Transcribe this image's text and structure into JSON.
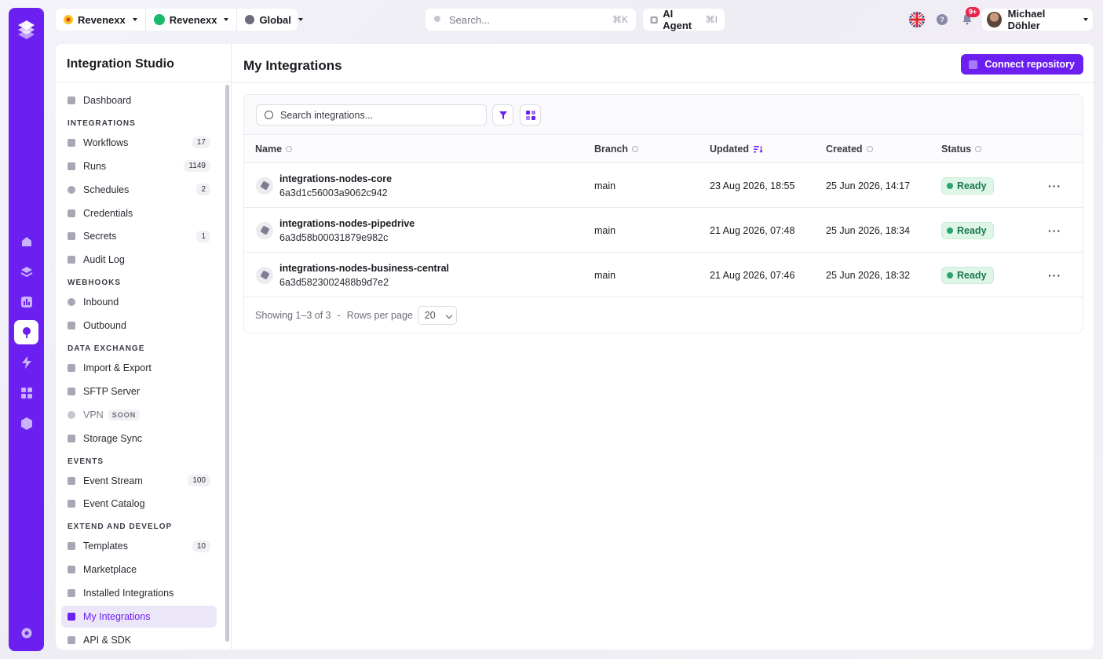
{
  "topbar": {
    "org_switch": [
      {
        "label": "Revenexx",
        "color": "#f5c518"
      },
      {
        "label": "Revenexx",
        "color": "#19b86b"
      },
      {
        "label": "Global",
        "color": "#6b6b7a"
      }
    ],
    "search": {
      "placeholder": "Search...",
      "shortcut": "⌘K"
    },
    "ai_agent": {
      "label": "AI Agent",
      "shortcut": "⌘I"
    },
    "notifications_badge": "9+",
    "user": {
      "name": "Michael Döhler"
    }
  },
  "rail": {
    "items": [
      "home-icon",
      "layers-icon",
      "chart-icon",
      "integrations-icon",
      "bolt-icon",
      "apps-icon",
      "cube-icon",
      "settings-icon"
    ],
    "active": "integrations-icon",
    "accent": "#6b1ff0"
  },
  "sidebar": {
    "title": "Integration Studio",
    "dashboard": {
      "label": "Dashboard"
    },
    "sections": {
      "integrations": "INTEGRATIONS",
      "webhooks": "WEBHOOKS",
      "data_exchange": "DATA EXCHANGE",
      "events": "EVENTS",
      "extend": "EXTEND AND DEVELOP"
    },
    "items": {
      "workflows": {
        "label": "Workflows",
        "count": "17"
      },
      "runs": {
        "label": "Runs",
        "count": "1149"
      },
      "schedules": {
        "label": "Schedules",
        "count": "2"
      },
      "credentials": {
        "label": "Credentials"
      },
      "secrets": {
        "label": "Secrets",
        "count": "1"
      },
      "audit_log": {
        "label": "Audit Log"
      },
      "inbound": {
        "label": "Inbound"
      },
      "outbound": {
        "label": "Outbound"
      },
      "import_export": {
        "label": "Import & Export"
      },
      "sftp": {
        "label": "SFTP Server"
      },
      "vpn": {
        "label": "VPN",
        "badge": "SOON"
      },
      "storage_sync": {
        "label": "Storage Sync"
      },
      "event_stream": {
        "label": "Event Stream",
        "count": "100"
      },
      "event_catalog": {
        "label": "Event Catalog"
      },
      "templates": {
        "label": "Templates",
        "count": "10"
      },
      "marketplace": {
        "label": "Marketplace"
      },
      "installed": {
        "label": "Installed Integrations"
      },
      "my_integrations": {
        "label": "My Integrations"
      },
      "api_sdk": {
        "label": "API & SDK"
      }
    }
  },
  "main": {
    "title": "My Integrations",
    "connect_button": "Connect repository",
    "search_placeholder": "Search integrations...",
    "columns": {
      "name": "Name",
      "branch": "Branch",
      "updated": "Updated",
      "created": "Created",
      "status": "Status"
    },
    "rows": [
      {
        "name": "integrations-nodes-core",
        "hash": "6a3d1c56003a9062c942",
        "branch": "main",
        "updated": "23 Aug 2026, 18:55",
        "created": "25 Jun 2026, 14:17",
        "status": "Ready"
      },
      {
        "name": "integrations-nodes-pipedrive",
        "hash": "6a3d58b00031879e982c",
        "branch": "main",
        "updated": "21 Aug 2026, 07:48",
        "created": "25 Jun 2026, 18:34",
        "status": "Ready"
      },
      {
        "name": "integrations-nodes-business-central",
        "hash": "6a3d5823002488b9d7e2",
        "branch": "main",
        "updated": "21 Aug 2026, 07:46",
        "created": "25 Jun 2026, 18:32",
        "status": "Ready"
      }
    ],
    "footer": {
      "showing": "Showing 1–3 of 3",
      "separator": "-",
      "rows_per_page_label": "Rows per page",
      "rows_per_page_value": "20"
    }
  }
}
